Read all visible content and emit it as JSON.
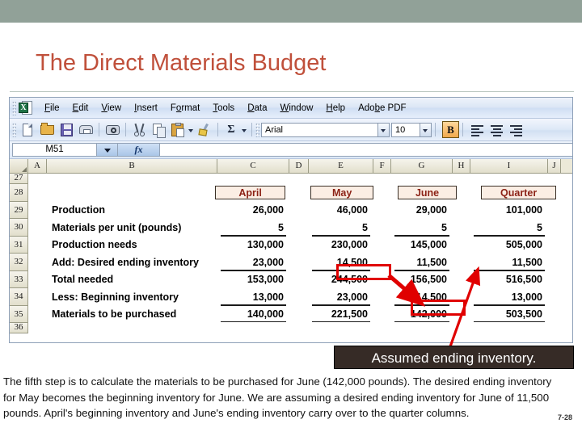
{
  "slide": {
    "title": "The Direct Materials Budget",
    "page_number": "7-28",
    "accent_color": "#c0503b",
    "band_color": "#91a198"
  },
  "excel": {
    "app_icon": "excel-logo-icon",
    "menus": [
      {
        "label": "File",
        "mnemonic": "F"
      },
      {
        "label": "Edit",
        "mnemonic": "E"
      },
      {
        "label": "View",
        "mnemonic": "V"
      },
      {
        "label": "Insert",
        "mnemonic": "I"
      },
      {
        "label": "Format",
        "mnemonic": "o"
      },
      {
        "label": "Tools",
        "mnemonic": "T"
      },
      {
        "label": "Data",
        "mnemonic": "D"
      },
      {
        "label": "Window",
        "mnemonic": "W"
      },
      {
        "label": "Help",
        "mnemonic": "H"
      },
      {
        "label": "Adobe PDF",
        "mnemonic": "b"
      }
    ],
    "toolbar_icons": [
      "new-document-icon",
      "open-folder-icon",
      "save-icon",
      "print-icon",
      "print-preview-icon",
      "cut-icon",
      "copy-icon",
      "paste-icon",
      "format-painter-icon",
      "autosum-icon"
    ],
    "font_name": "Arial",
    "font_size": "10",
    "bold_label": "B",
    "bold_active": true,
    "name_box": "M51",
    "fx_label": "fx",
    "formula_value": "",
    "columns": [
      "A",
      "B",
      "C",
      "D",
      "E",
      "F",
      "G",
      "H",
      "I",
      "J"
    ]
  },
  "sheet": {
    "row_numbers": [
      "27",
      "28",
      "29",
      "30",
      "31",
      "32",
      "33",
      "34",
      "35",
      "36"
    ],
    "headers": [
      "April",
      "May",
      "June",
      "Quarter"
    ],
    "rows": [
      {
        "row": "29",
        "label": "Production",
        "values": [
          "26,000",
          "46,000",
          "29,000",
          "101,000"
        ],
        "rule": "none"
      },
      {
        "row": "30",
        "label": "Materials per unit (pounds)",
        "values": [
          "5",
          "5",
          "5",
          "5"
        ],
        "rule": "single"
      },
      {
        "row": "31",
        "label": "Production needs",
        "values": [
          "130,000",
          "230,000",
          "145,000",
          "505,000"
        ],
        "rule": "none"
      },
      {
        "row": "32",
        "label": "Add: Desired ending inventory",
        "values": [
          "23,000",
          "14,500",
          "11,500",
          "11,500"
        ],
        "rule": "single"
      },
      {
        "row": "33",
        "label": "Total needed",
        "values": [
          "153,000",
          "244,500",
          "156,500",
          "516,500"
        ],
        "rule": "none"
      },
      {
        "row": "34",
        "label": "Less: Beginning inventory",
        "values": [
          "13,000",
          "23,000",
          "14,500",
          "13,000"
        ],
        "rule": "single"
      },
      {
        "row": "35",
        "label": "Materials to be purchased",
        "values": [
          "140,000",
          "221,500",
          "142,000",
          "503,500"
        ],
        "rule": "double"
      }
    ]
  },
  "annotations": {
    "callout_text": "Assumed ending inventory.",
    "highlight_color": "#e00000",
    "highlights": [
      {
        "name": "may-ending-inventory-highlight",
        "cell": "14,500"
      },
      {
        "name": "june-beginning-inventory-highlight",
        "cell": "14,500"
      }
    ]
  },
  "narration": {
    "paragraph": "The fifth step is to calculate the materials to be purchased for June (142,000 pounds). The desired ending inventory for May becomes the beginning inventory for June. We are assuming a desired ending inventory for June of 11,500 pounds. April's beginning inventory and June's ending inventory carry over to the quarter columns."
  }
}
